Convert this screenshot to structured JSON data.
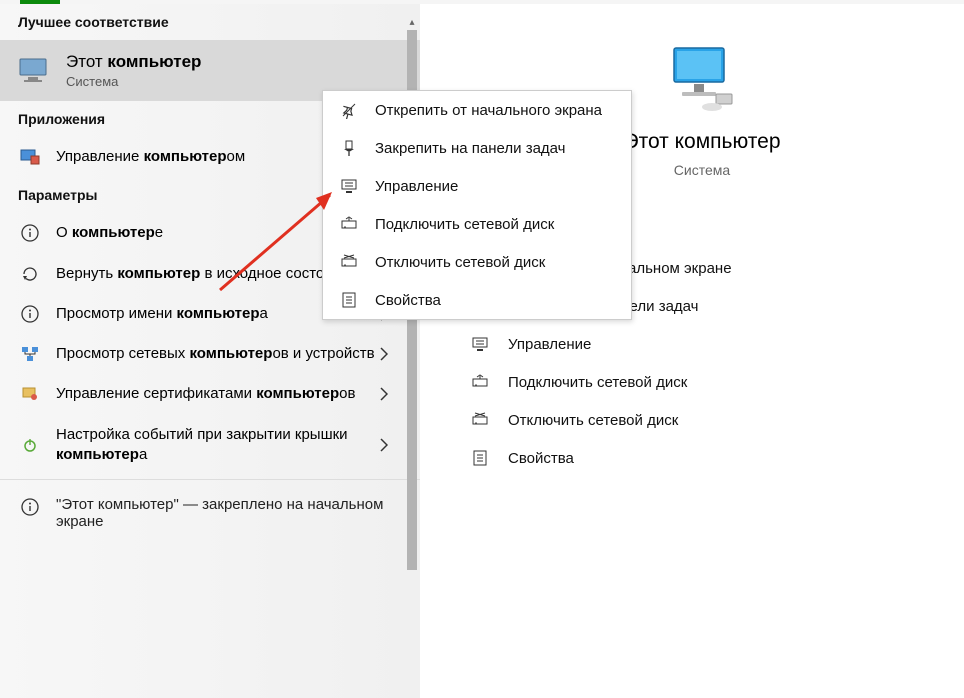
{
  "left": {
    "best_match_header": "Лучшее соответствие",
    "best_match": {
      "title_prefix": "Этот ",
      "title_bold": "компьютер",
      "subtitle": "Система"
    },
    "apps_header": "Приложения",
    "apps": [
      {
        "label_prefix": "Управление ",
        "label_bold": "компьютер",
        "label_suffix": "ом",
        "icon": "manage-computer"
      }
    ],
    "settings_header": "Параметры",
    "settings": [
      {
        "label_prefix": "О ",
        "label_bold": "компьютер",
        "label_suffix": "е",
        "icon": "info"
      },
      {
        "label_prefix": "Вернуть ",
        "label_bold": "компьютер",
        "label_suffix": " в исходное состояние",
        "icon": "reset"
      },
      {
        "label_prefix": "Просмотр имени ",
        "label_bold": "компьютер",
        "label_suffix": "а",
        "icon": "info"
      },
      {
        "label_prefix": "Просмотр сетевых ",
        "label_bold": "компьютер",
        "label_suffix": "ов и устройств",
        "icon": "network"
      },
      {
        "label_prefix": "Управление сертификатами ",
        "label_bold": "компьютер",
        "label_suffix": "ов",
        "icon": "cert"
      },
      {
        "label_prefix": "Настройка событий при закрытии крышки ",
        "label_bold": "компьютер",
        "label_suffix": "а",
        "icon": "power"
      }
    ],
    "footnote_prefix": "\"Этот ",
    "footnote_bold": "компьютер",
    "footnote_suffix": "\" — закреплено на начальном экране"
  },
  "context_menu": [
    {
      "label": "Открепить от начального экрана",
      "icon": "unpin"
    },
    {
      "label": "Закрепить на панели задач",
      "icon": "pin-taskbar"
    },
    {
      "label": "Управление",
      "icon": "manage"
    },
    {
      "label": "Подключить сетевой диск",
      "icon": "map-drive"
    },
    {
      "label": "Отключить сетевой диск",
      "icon": "disconnect-drive"
    },
    {
      "label": "Свойства",
      "icon": "properties"
    }
  ],
  "right": {
    "title": "Этот компьютер",
    "subtitle": "Система",
    "actions_visible_partial": "альном экране",
    "actions": [
      {
        "label": "Закрепить на панели задач",
        "icon": "pin-taskbar"
      },
      {
        "label": "Управление",
        "icon": "manage"
      },
      {
        "label": "Подключить сетевой диск",
        "icon": "map-drive"
      },
      {
        "label": "Отключить сетевой диск",
        "icon": "disconnect-drive"
      },
      {
        "label": "Свойства",
        "icon": "properties"
      }
    ]
  }
}
